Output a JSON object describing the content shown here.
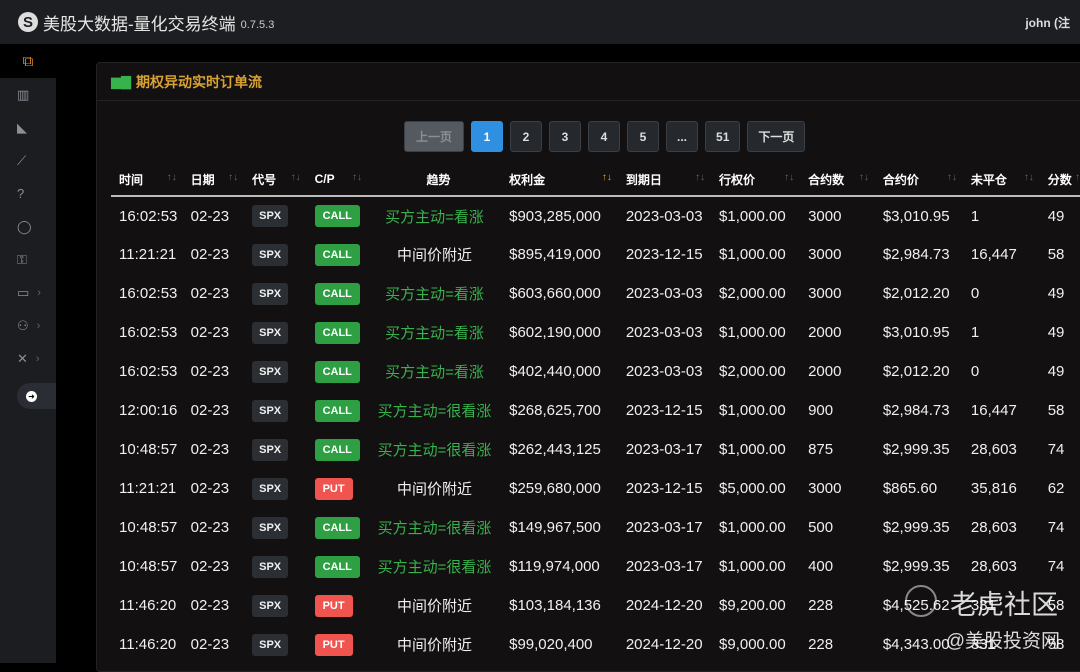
{
  "header": {
    "title": "美股大数据-量化交易终端",
    "version": "0.7.5.3",
    "user": "john (注"
  },
  "sidebar": {
    "items": [
      {
        "name": "flow-icon",
        "g": "⧉"
      },
      {
        "name": "chart-icon",
        "g": "▥"
      },
      {
        "name": "whale-icon",
        "g": "◣"
      },
      {
        "name": "trend-icon",
        "g": "⟋"
      },
      {
        "name": "help-icon",
        "g": "?"
      },
      {
        "name": "user-icon",
        "g": "◯"
      },
      {
        "name": "user-lock-icon",
        "g": "⚿"
      },
      {
        "name": "monitor-icon",
        "g": "▭"
      },
      {
        "name": "users-icon",
        "g": "⚇"
      },
      {
        "name": "tools-icon",
        "g": "✕"
      }
    ]
  },
  "card": {
    "title": "期权异动实时订单流"
  },
  "pagination": {
    "prev": "上一页",
    "pages": [
      "1",
      "2",
      "3",
      "4",
      "5",
      "...",
      "51"
    ],
    "next": "下一页",
    "current": "1"
  },
  "columns": [
    "时间",
    "日期",
    "代号",
    "C/P",
    "趋势",
    "权利金",
    "到期日",
    "行权价",
    "合约数",
    "合约价",
    "未平仓",
    "分数"
  ],
  "colors": {
    "call": "#2ea043",
    "put": "#f0544f",
    "bull": "#37b24d",
    "neutral": "#f0f0f0"
  },
  "rows": [
    [
      "16:02:53",
      "02-23",
      "SPX",
      "CALL",
      "买方主动=看涨",
      "$903,285,000",
      "2023-03-03",
      "$1,000.00",
      "3000",
      "$3,010.95",
      "1",
      "49"
    ],
    [
      "11:21:21",
      "02-23",
      "SPX",
      "CALL",
      "中间价附近",
      "$895,419,000",
      "2023-12-15",
      "$1,000.00",
      "3000",
      "$2,984.73",
      "16,447",
      "58"
    ],
    [
      "16:02:53",
      "02-23",
      "SPX",
      "CALL",
      "买方主动=看涨",
      "$603,660,000",
      "2023-03-03",
      "$2,000.00",
      "3000",
      "$2,012.20",
      "0",
      "49"
    ],
    [
      "16:02:53",
      "02-23",
      "SPX",
      "CALL",
      "买方主动=看涨",
      "$602,190,000",
      "2023-03-03",
      "$1,000.00",
      "2000",
      "$3,010.95",
      "1",
      "49"
    ],
    [
      "16:02:53",
      "02-23",
      "SPX",
      "CALL",
      "买方主动=看涨",
      "$402,440,000",
      "2023-03-03",
      "$2,000.00",
      "2000",
      "$2,012.20",
      "0",
      "49"
    ],
    [
      "12:00:16",
      "02-23",
      "SPX",
      "CALL",
      "买方主动=很看涨",
      "$268,625,700",
      "2023-12-15",
      "$1,000.00",
      "900",
      "$2,984.73",
      "16,447",
      "58"
    ],
    [
      "10:48:57",
      "02-23",
      "SPX",
      "CALL",
      "买方主动=很看涨",
      "$262,443,125",
      "2023-03-17",
      "$1,000.00",
      "875",
      "$2,999.35",
      "28,603",
      "74"
    ],
    [
      "11:21:21",
      "02-23",
      "SPX",
      "PUT",
      "中间价附近",
      "$259,680,000",
      "2023-12-15",
      "$5,000.00",
      "3000",
      "$865.60",
      "35,816",
      "62"
    ],
    [
      "10:48:57",
      "02-23",
      "SPX",
      "CALL",
      "买方主动=很看涨",
      "$149,967,500",
      "2023-03-17",
      "$1,000.00",
      "500",
      "$2,999.35",
      "28,603",
      "74"
    ],
    [
      "10:48:57",
      "02-23",
      "SPX",
      "CALL",
      "买方主动=很看涨",
      "$119,974,000",
      "2023-03-17",
      "$1,000.00",
      "400",
      "$2,999.35",
      "28,603",
      "74"
    ],
    [
      "11:46:20",
      "02-23",
      "SPX",
      "PUT",
      "中间价附近",
      "$103,184,136",
      "2024-12-20",
      "$9,200.00",
      "228",
      "$4,525.62",
      "331",
      "58"
    ],
    [
      "11:46:20",
      "02-23",
      "SPX",
      "PUT",
      "中间价附近",
      "$99,020,400",
      "2024-12-20",
      "$9,000.00",
      "228",
      "$4,343.00",
      "331",
      "58"
    ]
  ],
  "watermark": {
    "line1": "老虎社区",
    "line2": "@美股投资网"
  }
}
